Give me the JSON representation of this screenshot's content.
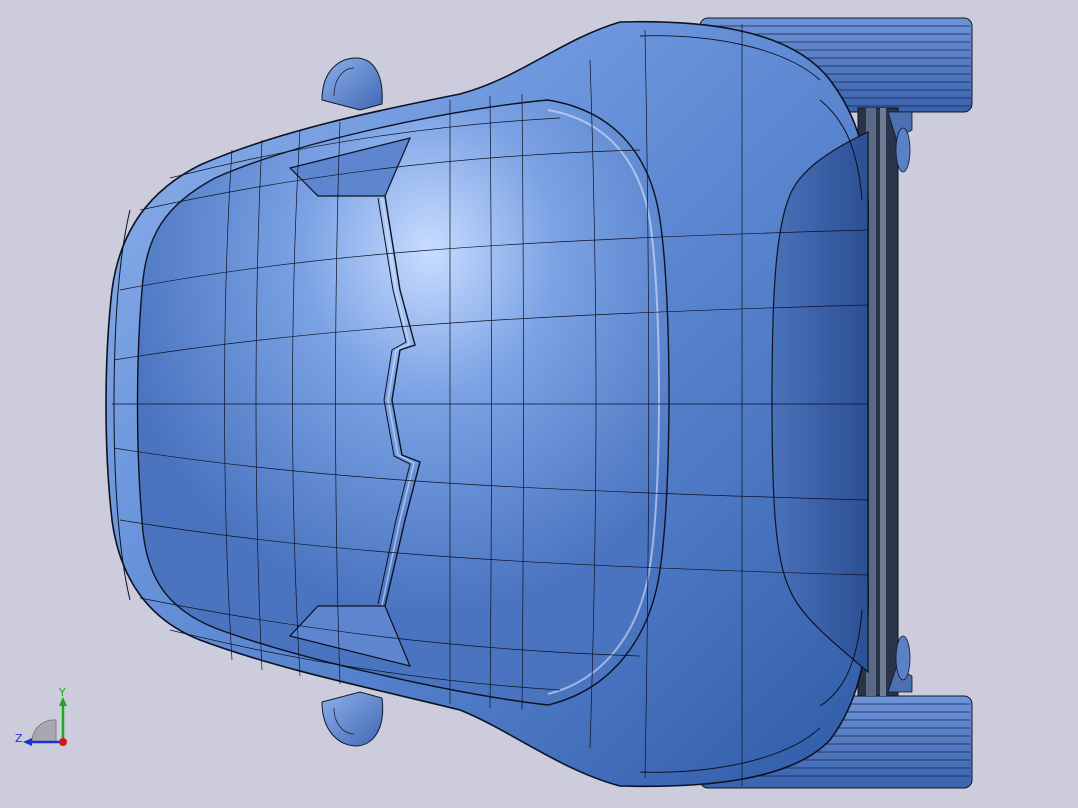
{
  "viewport": {
    "background": "#ccccdd",
    "model_color": "#5a86d0",
    "edge_color": "#101828"
  },
  "triad": {
    "y_label": "Y",
    "z_label": "Z",
    "y_color": "#1fa81f",
    "z_color": "#2030d0",
    "x_color": "#d01818"
  }
}
